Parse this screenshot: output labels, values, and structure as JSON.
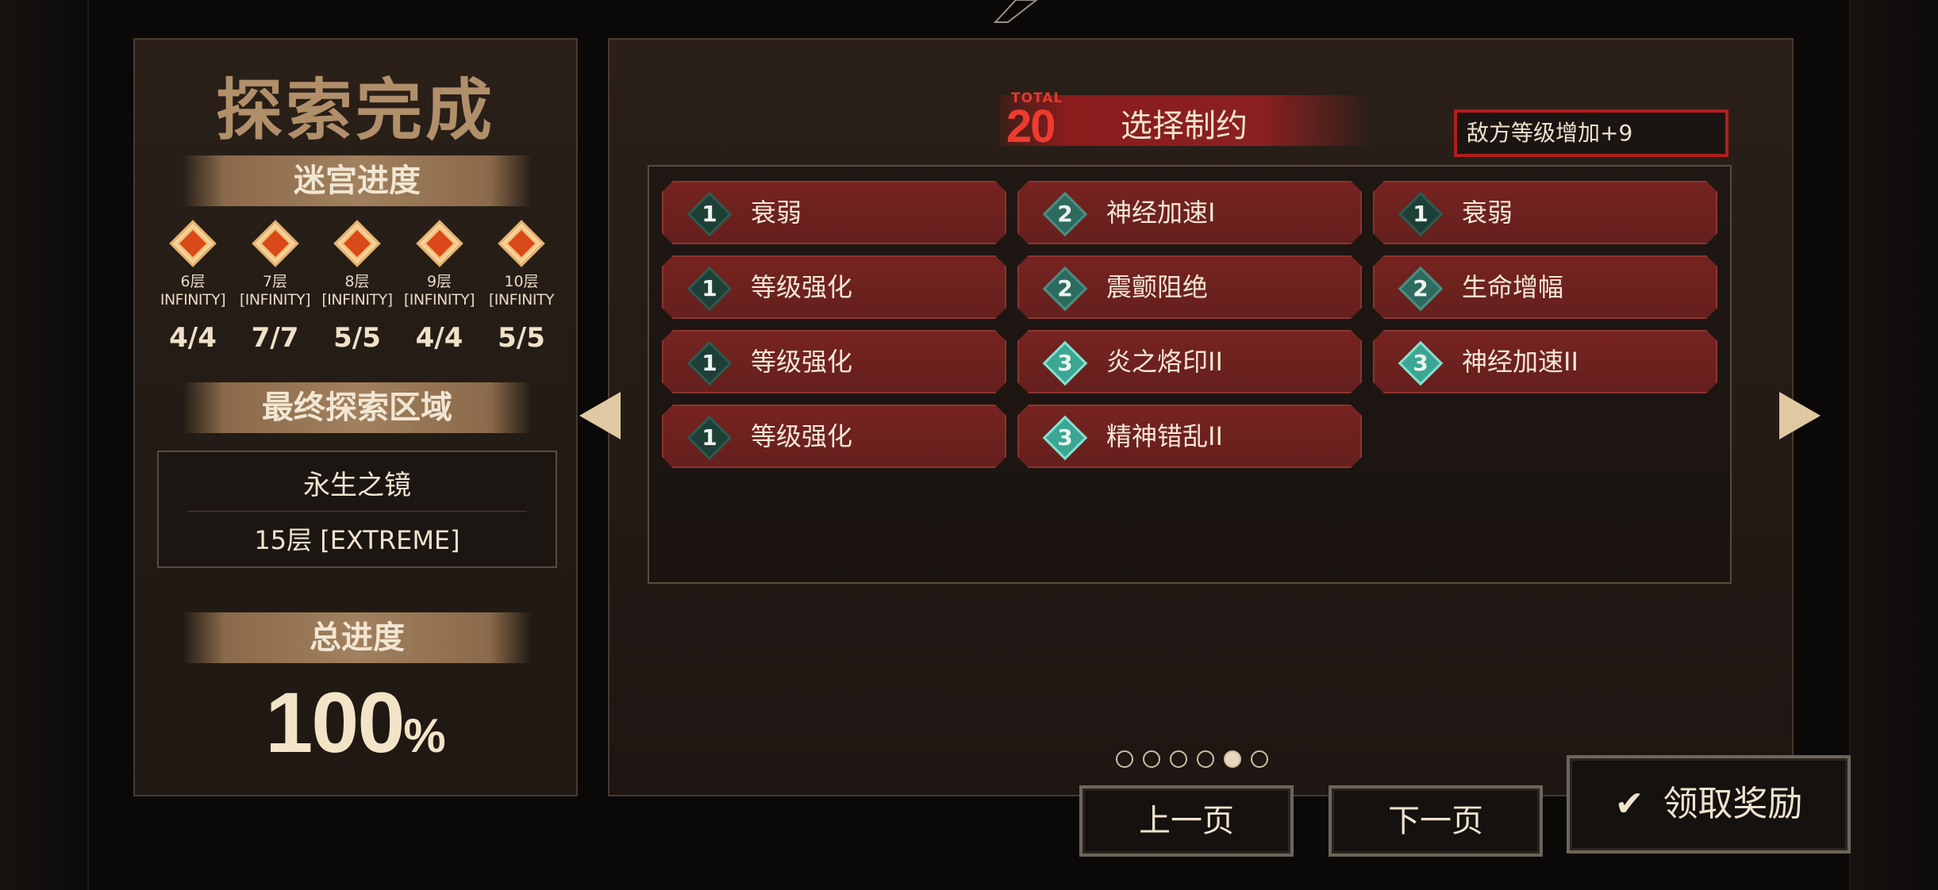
{
  "left_panel": {
    "title": "探索完成",
    "maze_progress_label": "迷宫进度",
    "floors": [
      {
        "name": "6层",
        "difficulty": "INFINITY]",
        "progress": "4/4"
      },
      {
        "name": "7层",
        "difficulty": "[INFINITY]",
        "progress": "7/7"
      },
      {
        "name": "8层",
        "difficulty": "[INFINITY]",
        "progress": "5/5"
      },
      {
        "name": "9层",
        "difficulty": "[INFINITY]",
        "progress": "4/4"
      },
      {
        "name": "10层",
        "difficulty": "[INFINITY",
        "progress": "5/5"
      }
    ],
    "final_zone_label": "最终探索区域",
    "final_zone": {
      "name": "永生之镜",
      "floor": "15层 [EXTREME]"
    },
    "total_progress_label": "总进度",
    "total_progress_value": "100",
    "total_progress_unit": "%"
  },
  "right_panel": {
    "total_label": "TOTAL",
    "total_value": "20",
    "title": "选择制约",
    "effect_text": "敌方等级增加+9",
    "constraints": [
      {
        "level": "1",
        "name": "衰弱"
      },
      {
        "level": "2",
        "name": "神经加速I"
      },
      {
        "level": "1",
        "name": "衰弱"
      },
      {
        "level": "1",
        "name": "等级强化"
      },
      {
        "level": "2",
        "name": "震颤阻绝"
      },
      {
        "level": "2",
        "name": "生命增幅"
      },
      {
        "level": "1",
        "name": "等级强化"
      },
      {
        "level": "3",
        "name": "炎之烙印II"
      },
      {
        "level": "3",
        "name": "神经加速II"
      },
      {
        "level": "1",
        "name": "等级强化"
      },
      {
        "level": "3",
        "name": "精神错乱II"
      }
    ],
    "pagination": {
      "total_pages": 6,
      "current_page": 5
    }
  },
  "buttons": {
    "prev": "上一页",
    "next": "下一页",
    "claim": "领取奖励"
  },
  "icons": {
    "claim": "checkmark-icon",
    "prev_arrow": "triangle-left-icon",
    "next_arrow": "triangle-right-icon"
  },
  "colors": {
    "accent_red": "#b11d1d",
    "card_red": "#6f221f",
    "gold": "#b08f6a"
  }
}
